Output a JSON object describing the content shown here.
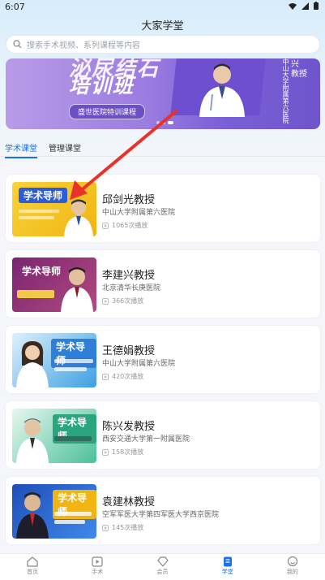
{
  "status_bar": {
    "time": "6:07"
  },
  "header": {
    "title": "大家学堂"
  },
  "search": {
    "placeholder": "搜索手术视频、系列课程等内容"
  },
  "banner": {
    "title_top": "泌尿结石",
    "title_main": "培训班",
    "caption": "盛世医院特训课程",
    "side_text": "中山大学附属第六医院",
    "side_title": "兴\n教授"
  },
  "tabs": [
    {
      "label": "学术课堂",
      "active": true
    },
    {
      "label": "管理课堂",
      "active": false
    }
  ],
  "courses": [
    {
      "tag": "学术导师",
      "name": "邱剑光教授",
      "hospital": "中山大学附属第六医院",
      "views": "1065次播放",
      "thumb_color": "#f4c21a"
    },
    {
      "tag": "学术导师",
      "name": "李建兴教授",
      "hospital": "北京清华长庚医院",
      "views": "366次播放",
      "thumb_color": "#8b2c7a"
    },
    {
      "tag": "学术导师",
      "name": "王德娟教授",
      "hospital": "中山大学附属第六医院",
      "views": "420次播放",
      "thumb_color": "#3aa0e6"
    },
    {
      "tag": "学术导师",
      "name": "陈兴发教授",
      "hospital": "西安交通大学第一附属医院",
      "views": "158次播放",
      "thumb_color": "#56c4a0"
    },
    {
      "tag": "学术导师",
      "name": "袁建林教授",
      "hospital": "空军军医大学第四军医大学西京医院",
      "views": "145次播放",
      "thumb_color": "#2a6fd6"
    }
  ],
  "bottom_nav": [
    {
      "label": "首页",
      "icon": "home-icon",
      "active": false
    },
    {
      "label": "手术",
      "icon": "video-icon",
      "active": false
    },
    {
      "label": "会员",
      "icon": "diamond-icon",
      "active": false
    },
    {
      "label": "学堂",
      "icon": "book-icon",
      "active": true
    },
    {
      "label": "我的",
      "icon": "profile-icon",
      "active": false
    }
  ],
  "colors": {
    "accent": "#1a73e8",
    "arrow": "#e8322b"
  }
}
